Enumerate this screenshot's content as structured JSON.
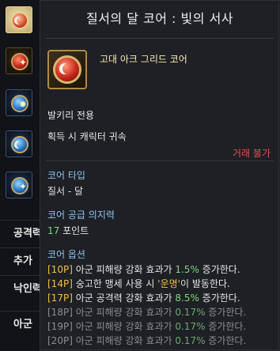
{
  "sidebar": {
    "labels": [
      "공격력",
      "추가",
      "낙인력",
      "아군"
    ]
  },
  "tooltip": {
    "title": "질서의 달 코어 : 빛의 서사",
    "item_name": "고대 아크 그리드 코어",
    "class_restriction": "발키리 전용",
    "bind": "획득 시 캐릭터 귀속",
    "trade": "거래 불가",
    "core_type_label": "코어 타입",
    "core_type_value": "질서 - 달",
    "supply_label": "코어 공급 의지력",
    "supply_num": "17",
    "supply_unit": " 포인트",
    "options_label": "코어 옵션",
    "options": [
      {
        "level": "[10P]",
        "pre": " 아군 피해량 강화 효과가 ",
        "value": "1.5%",
        "post": " 증가한다."
      },
      {
        "level": "[14P]",
        "pre": " 숭고한 맹세 사용 시 ",
        "value": "'운명'",
        "post": "이 발동한다."
      },
      {
        "level": "[17P]",
        "pre": " 아군 공격력 강화 효과가 ",
        "value": "8.5%",
        "post": " 증가한다."
      },
      {
        "level": "[18P]",
        "pre": " 아군 피해량 강화 효과가 ",
        "value": "0.17%",
        "post": " 증가한다."
      },
      {
        "level": "[19P]",
        "pre": " 아군 피해량 강화 효과가 ",
        "value": "0.17%",
        "post": " 증가한다."
      },
      {
        "level": "[20P]",
        "pre": " 아군 피해량 강화 효과가 ",
        "value": "0.17%",
        "post": " 증가한다."
      }
    ]
  }
}
